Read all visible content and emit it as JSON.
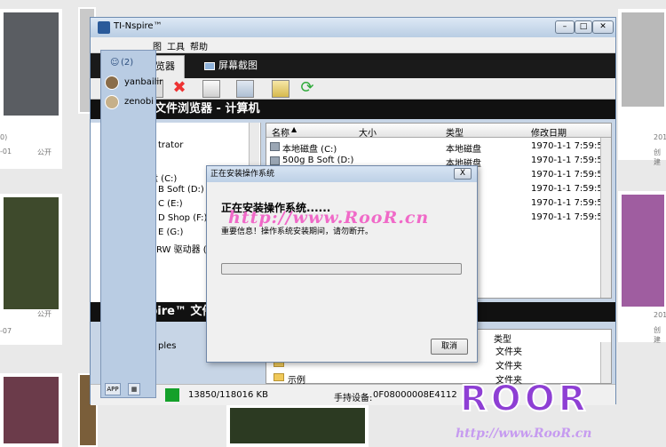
{
  "window": {
    "title": "TI-Nspire™",
    "menu": [
      "图",
      "工具",
      "帮助"
    ],
    "tabs": [
      "览器",
      "屏幕截图"
    ],
    "panel_title": "文件浏览器 - 计算机",
    "lower_panel_title": "pire™ 文件"
  },
  "left_tree": [
    "trator",
    "盘 (C:)",
    "B Soft (D:)",
    "C (E:)",
    "D Shop (F:)",
    "E (G:)",
    "RW 驱动器 (H:"
  ],
  "file_list": {
    "columns": [
      "名称",
      "大小",
      "类型",
      "修改日期"
    ],
    "rows": [
      {
        "name": "本地磁盘 (C:)",
        "type": "本地磁盘",
        "date": "1970-1-1 7:59:59"
      },
      {
        "name": "500g B Soft (D:)",
        "type": "本地磁盘",
        "date": "1970-1-1 7:59:59"
      },
      {
        "name": "",
        "type": "",
        "date": "1970-1-1 7:59:59"
      },
      {
        "name": "",
        "type": "",
        "date": "1970-1-1 7:59:59"
      },
      {
        "name": "",
        "type": "",
        "date": "1970-1-1 7:59:59"
      },
      {
        "name": "",
        "type": "盘",
        "date": "1970-1-1 7:59:59"
      }
    ]
  },
  "lower_panel": {
    "left_text": "ples",
    "type_header": "类型",
    "rows": [
      {
        "name": "",
        "type": "文件夹"
      },
      {
        "name": "",
        "type": "文件夹"
      },
      {
        "name": "示例",
        "type": "文件夹"
      }
    ]
  },
  "status": {
    "storage": "13850/118016 KB",
    "device_label": "手持设备:",
    "device_id": "0F08000008E4112"
  },
  "sidepanel": {
    "count": "(2)",
    "users": [
      "yanbailir",
      "zenobi"
    ],
    "buttons": [
      "APP",
      ""
    ]
  },
  "dialog": {
    "title": "正在安装操作系统",
    "heading": "正在安装操作系统......",
    "message": "重要信息！操作系统安装期间，请勿断开。",
    "progress": 0.0,
    "cancel_label": "取消",
    "close_label": "X"
  },
  "watermark": {
    "url": "http://www.RooR.cn",
    "logo": "ROOR",
    "logo_url": "http://www.RooR.cn"
  },
  "background_captions": [
    "0)",
    "-01",
    "公开",
    "公开",
    "-07",
    "201",
    "创建",
    "201",
    "创建"
  ]
}
